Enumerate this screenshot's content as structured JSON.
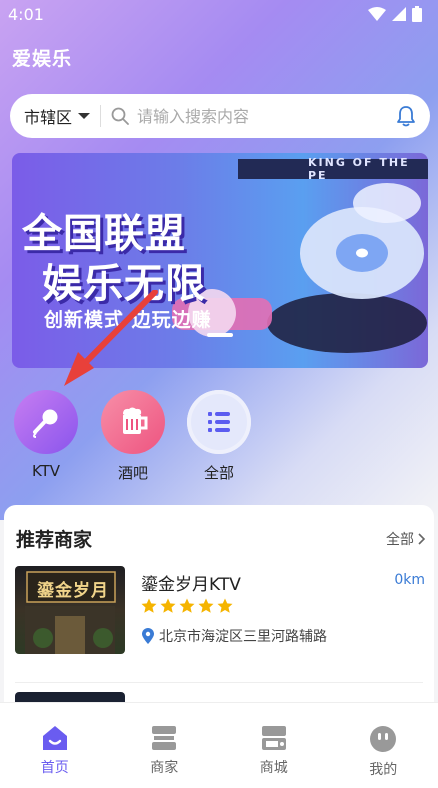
{
  "status": {
    "time": "4:01"
  },
  "app": {
    "title": "爱娱乐"
  },
  "search": {
    "district": "市辖区",
    "placeholder": "请输入搜索内容"
  },
  "banner": {
    "ribbon": "KING OF THE PE",
    "line1": "全国联盟",
    "line2": "娱乐无限",
    "line3": "创新模式 边玩边赚"
  },
  "categories": [
    {
      "label": "KTV",
      "icon": "microphone-icon",
      "color": "#a35cf0"
    },
    {
      "label": "酒吧",
      "icon": "beer-icon",
      "color": "#f06a8c"
    },
    {
      "label": "全部",
      "icon": "list-icon",
      "color": "#6a5cf0"
    }
  ],
  "section": {
    "title": "推荐商家",
    "more": "全部"
  },
  "merchants": [
    {
      "name": "鎏金岁月KTV",
      "distance": "0km",
      "rating": 5,
      "address": "北京市海淀区三里河路辅路",
      "sign": "鎏金岁月"
    }
  ],
  "tabs": [
    {
      "label": "首页",
      "icon": "home-icon",
      "active": true
    },
    {
      "label": "商家",
      "icon": "store-icon",
      "active": false
    },
    {
      "label": "商城",
      "icon": "mall-icon",
      "active": false
    },
    {
      "label": "我的",
      "icon": "profile-icon",
      "active": false
    }
  ],
  "colors": {
    "accent": "#6a5cf0",
    "distance": "#3a7bd5",
    "star": "#f5b400"
  }
}
